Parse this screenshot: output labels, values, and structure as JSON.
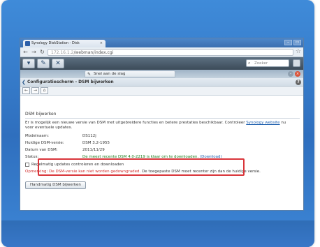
{
  "browser": {
    "tab_title": "Synology DiskStation - Disk",
    "tab_close": "×",
    "url_host": "172.16.1.2",
    "url_path": "/webman/index.cgi",
    "win_min": "–",
    "win_max": "▭"
  },
  "dsm": {
    "search_placeholder": "Zoeker"
  },
  "desktop": {
    "sticky_title": "Snel aan de slag"
  },
  "control_panel": {
    "title": "Configuratiescherm - DSM bijwerken"
  },
  "update": {
    "section_title": "DSM bijwerken",
    "intro": "Er is mogelijk een nieuwe versie van DSM met uitgebreidere functies en betere prestaties beschikbaar. Controleer",
    "intro_link": "Synology website",
    "intro_rest": "nu voor eventuele updates.",
    "model_label": "Modelnaam:",
    "model_value": "DS112j",
    "version_label": "Huidige DSM-versie:",
    "version_value": "DSM 3.2-1955",
    "date_label": "Datum van DSM:",
    "date_value": "2011/11/29",
    "status_label": "Status:",
    "status_value": "De meest recente DSM 4.0-2219 is klaar om te downloaden.",
    "status_link": "(Download)",
    "checkbox_label": "Regelmatig updates controleren en downloaden",
    "warning_red": "Opmerking: De DSM-versie kan niet worden gedowngraded.",
    "warning_rest": "De toegepaste DSM moet recenter zijn dan de huidige versie.",
    "manual_button": "Handmatig DSM bijwerken"
  }
}
